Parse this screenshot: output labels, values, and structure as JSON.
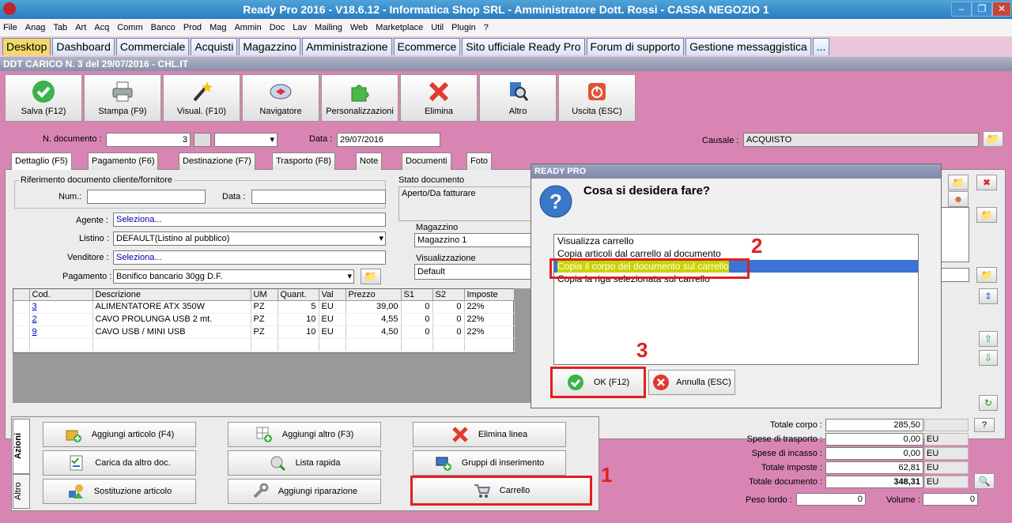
{
  "window": {
    "title": "Ready Pro 2016 - V18.6.12 - Informatica Shop SRL - Amministratore Dott. Rossi - CASSA NEGOZIO 1"
  },
  "menu": [
    "File",
    "Anag",
    "Tab",
    "Art",
    "Acq",
    "Comm",
    "Banco",
    "Prod",
    "Mag",
    "Ammin",
    "Doc",
    "Lav",
    "Mailing",
    "Web",
    "Marketplace",
    "Util",
    "Plugin",
    "?"
  ],
  "tabs": [
    "Desktop",
    "Dashboard",
    "Commerciale",
    "Acquisti",
    "Magazzino",
    "Amministrazione",
    "Ecommerce",
    "Sito ufficiale Ready Pro",
    "Forum di supporto",
    "Gestione messaggistica",
    "..."
  ],
  "doc_title": "DDT CARICO N. 3 del 29/07/2016 - CHL.IT",
  "toolbar": [
    "Salva (F12)",
    "Stampa (F9)",
    "Visual. (F10)",
    "Navigatore",
    "Personalizzazioni",
    "Elimina",
    "Altro",
    "Uscita (ESC)"
  ],
  "header": {
    "ndoc_label": "N. documento :",
    "ndoc_value": "3",
    "data_label": "Data :",
    "data_value": "29/07/2016",
    "causale_label": "Causale :",
    "causale_value": "ACQUISTO"
  },
  "inner_tabs": [
    "Dettaglio (F5)",
    "Pagamento (F6)",
    "Destinazione (F7)",
    "Trasporto (F8)",
    "Note",
    "Documenti",
    "Foto"
  ],
  "detail": {
    "rif_label": "Riferimento documento cliente/fornitore",
    "num_label": "Num.:",
    "data_label": "Data :",
    "stato_label": "Stato documento",
    "stato_value": "Aperto/Da fatturare",
    "agente_label": "Agente :",
    "agente_value": "Seleziona...",
    "listino_label": "Listino :",
    "listino_value": "DEFAULT(Listino al pubblico)",
    "venditore_label": "Venditore :",
    "venditore_value": "Seleziona...",
    "pagamento_label": "Pagamento :",
    "pagamento_value": "Bonifico bancario 30gg D.F.",
    "magazzino_label": "Magazzino",
    "magazzino_value": "Magazzino 1",
    "visualizzazione_label": "Visualizzazione",
    "visualizzazione_value": "Default"
  },
  "grid": {
    "columns": [
      "Cod.",
      "Descrizione",
      "UM",
      "Quant.",
      "Val",
      "Prezzo",
      "S1",
      "S2",
      "Imposte"
    ],
    "rows": [
      [
        "3",
        "ALIMENTATORE ATX 350W",
        "PZ",
        "5",
        "EU",
        "39,00",
        "0",
        "0",
        "22%"
      ],
      [
        "2",
        "CAVO PROLUNGA USB 2 mt.",
        "PZ",
        "10",
        "EU",
        "4,55",
        "0",
        "0",
        "22%"
      ],
      [
        "9",
        "CAVO USB / MINI USB",
        "PZ",
        "10",
        "EU",
        "4,50",
        "0",
        "0",
        "22%"
      ]
    ]
  },
  "actions": {
    "side_tabs": [
      "Azioni",
      "Altro"
    ],
    "buttons": [
      "Aggiungi articolo (F4)",
      "Aggiungi altro (F3)",
      "Elimina linea",
      "Carica da altro doc.",
      "Lista rapida",
      "Gruppi di inserimento",
      "Sostituzione articolo",
      "Aggiungi riparazione",
      "Carrello"
    ]
  },
  "totals": {
    "rows": [
      {
        "label": "Totale corpo :",
        "value": "285,50",
        "unit": ""
      },
      {
        "label": "Spese di trasporto :",
        "value": "0,00",
        "unit": "EU"
      },
      {
        "label": "Spese di incasso :",
        "value": "0,00",
        "unit": "EU"
      },
      {
        "label": "Totale imposte :",
        "value": "62,81",
        "unit": "EU"
      },
      {
        "label": "Totale documento :",
        "value": "348,31",
        "unit": "EU"
      }
    ],
    "peso_label": "Peso lordo :",
    "peso_value": "0",
    "volume_label": "Volume :",
    "volume_value": "0",
    "help": "?"
  },
  "dialog": {
    "title": "READY PRO",
    "question": "Cosa si desidera fare?",
    "options": [
      "Visualizza carrello",
      "Copia articoli dal carrello al documento",
      "Copia il corpo del documento sul carrello",
      "Copia la riga selezionata sul carrello"
    ],
    "selected": 2,
    "ok": "OK (F12)",
    "cancel": "Annulla (ESC)"
  },
  "annotations": [
    "1",
    "2",
    "3"
  ],
  "colors": {
    "background": "#d985b3",
    "accent": "#3b73d6",
    "highlight": "#c8d400",
    "annotation": "#e02020"
  }
}
